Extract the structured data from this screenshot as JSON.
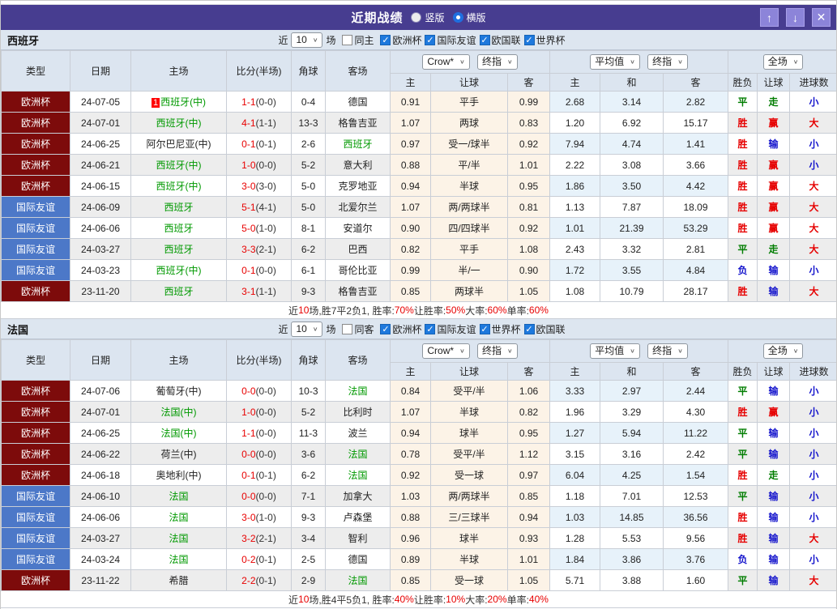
{
  "titlebar": {
    "title": "近期战绩",
    "radio_vertical": "竖版",
    "radio_horizontal": "横版",
    "btn_up": "↑",
    "btn_down": "↓",
    "btn_close": "✕"
  },
  "filter": {
    "near": "近",
    "count": "10",
    "games": "场"
  },
  "header": {
    "col_type": "类型",
    "col_date": "日期",
    "col_home": "主场",
    "col_score": "比分(半场)",
    "col_corner": "角球",
    "col_away": "客场",
    "sel_odds_source": "Crow*",
    "sel_odds_final": "终指",
    "odds_home": "主",
    "odds_handicap": "让球",
    "odds_away": "客",
    "sel_avg": "平均值",
    "sel_avg_final": "终指",
    "avg_home": "主",
    "avg_draw": "和",
    "avg_away": "客",
    "sel_scope": "全场",
    "res_wdl": "胜负",
    "res_handicap": "让球",
    "res_goals": "进球数"
  },
  "colors": {
    "titlebar_bg": "#473D90",
    "europe_cup_badge": "#7D0B0B",
    "friendly_badge": "#4C78C8",
    "team_green": "#009900",
    "score_red": "#E80000",
    "win_red": "#E60000",
    "draw_green": "#007D00",
    "lose_blue": "#1414CC",
    "odds_bg": "#FCF3E7",
    "avg_bg": "#E7F2FA",
    "header_bg": "#DCE5F0"
  },
  "sections": [
    {
      "team": "西班牙",
      "same_label": "同主",
      "competitions": [
        "欧洲杯",
        "国际友谊",
        "欧国联",
        "世界杯"
      ],
      "rows": [
        {
          "comp": "欧洲杯",
          "badge": "cup",
          "date": "24-07-05",
          "homeBadge": "1",
          "home": "西班牙(中)",
          "homeC": "g",
          "score": "1-1",
          "half": "(0-0)",
          "corner": "0-4",
          "away": "德国",
          "awayC": "k",
          "o": [
            "0.91",
            "平手",
            "0.99"
          ],
          "a": [
            "2.68",
            "3.14",
            "2.82"
          ],
          "r": [
            [
              "平",
              "g"
            ],
            [
              "走",
              "g"
            ],
            [
              "小",
              "b"
            ]
          ]
        },
        {
          "comp": "欧洲杯",
          "badge": "cup",
          "date": "24-07-01",
          "home": "西班牙(中)",
          "homeC": "g",
          "score": "4-1",
          "half": "(1-1)",
          "corner": "13-3",
          "away": "格鲁吉亚",
          "awayC": "k",
          "o": [
            "1.07",
            "两球",
            "0.83"
          ],
          "a": [
            "1.20",
            "6.92",
            "15.17"
          ],
          "r": [
            [
              "胜",
              "r"
            ],
            [
              "赢",
              "r"
            ],
            [
              "大",
              "r"
            ]
          ]
        },
        {
          "comp": "欧洲杯",
          "badge": "cup",
          "date": "24-06-25",
          "home": "阿尔巴尼亚(中)",
          "homeC": "k",
          "score": "0-1",
          "half": "(0-1)",
          "corner": "2-6",
          "away": "西班牙",
          "awayC": "g",
          "o": [
            "0.97",
            "受一/球半",
            "0.92"
          ],
          "a": [
            "7.94",
            "4.74",
            "1.41"
          ],
          "r": [
            [
              "胜",
              "r"
            ],
            [
              "输",
              "b"
            ],
            [
              "小",
              "b"
            ]
          ]
        },
        {
          "comp": "欧洲杯",
          "badge": "cup",
          "date": "24-06-21",
          "home": "西班牙(中)",
          "homeC": "g",
          "score": "1-0",
          "half": "(0-0)",
          "corner": "5-2",
          "away": "意大利",
          "awayC": "k",
          "o": [
            "0.88",
            "平/半",
            "1.01"
          ],
          "a": [
            "2.22",
            "3.08",
            "3.66"
          ],
          "r": [
            [
              "胜",
              "r"
            ],
            [
              "赢",
              "r"
            ],
            [
              "小",
              "b"
            ]
          ]
        },
        {
          "comp": "欧洲杯",
          "badge": "cup",
          "date": "24-06-15",
          "home": "西班牙(中)",
          "homeC": "g",
          "score": "3-0",
          "half": "(3-0)",
          "corner": "5-0",
          "away": "克罗地亚",
          "awayC": "k",
          "o": [
            "0.94",
            "半球",
            "0.95"
          ],
          "a": [
            "1.86",
            "3.50",
            "4.42"
          ],
          "r": [
            [
              "胜",
              "r"
            ],
            [
              "赢",
              "r"
            ],
            [
              "大",
              "r"
            ]
          ]
        },
        {
          "comp": "国际友谊",
          "badge": "fr",
          "date": "24-06-09",
          "home": "西班牙",
          "homeC": "g",
          "score": "5-1",
          "half": "(4-1)",
          "corner": "5-0",
          "away": "北爱尔兰",
          "awayC": "k",
          "o": [
            "1.07",
            "两/两球半",
            "0.81"
          ],
          "a": [
            "1.13",
            "7.87",
            "18.09"
          ],
          "r": [
            [
              "胜",
              "r"
            ],
            [
              "赢",
              "r"
            ],
            [
              "大",
              "r"
            ]
          ]
        },
        {
          "comp": "国际友谊",
          "badge": "fr",
          "date": "24-06-06",
          "home": "西班牙",
          "homeC": "g",
          "score": "5-0",
          "half": "(1-0)",
          "corner": "8-1",
          "away": "安道尔",
          "awayC": "k",
          "o": [
            "0.90",
            "四/四球半",
            "0.92"
          ],
          "a": [
            "1.01",
            "21.39",
            "53.29"
          ],
          "r": [
            [
              "胜",
              "r"
            ],
            [
              "赢",
              "r"
            ],
            [
              "大",
              "r"
            ]
          ]
        },
        {
          "comp": "国际友谊",
          "badge": "fr",
          "date": "24-03-27",
          "home": "西班牙",
          "homeC": "g",
          "score": "3-3",
          "half": "(2-1)",
          "corner": "6-2",
          "away": "巴西",
          "awayC": "k",
          "o": [
            "0.82",
            "平手",
            "1.08"
          ],
          "a": [
            "2.43",
            "3.32",
            "2.81"
          ],
          "r": [
            [
              "平",
              "g"
            ],
            [
              "走",
              "g"
            ],
            [
              "大",
              "r"
            ]
          ]
        },
        {
          "comp": "国际友谊",
          "badge": "fr",
          "date": "24-03-23",
          "home": "西班牙(中)",
          "homeC": "g",
          "score": "0-1",
          "half": "(0-0)",
          "corner": "6-1",
          "away": "哥伦比亚",
          "awayC": "k",
          "o": [
            "0.99",
            "半/一",
            "0.90"
          ],
          "a": [
            "1.72",
            "3.55",
            "4.84"
          ],
          "r": [
            [
              "负",
              "b"
            ],
            [
              "输",
              "b"
            ],
            [
              "小",
              "b"
            ]
          ]
        },
        {
          "comp": "欧洲杯",
          "badge": "cup",
          "date": "23-11-20",
          "home": "西班牙",
          "homeC": "g",
          "score": "3-1",
          "half": "(1-1)",
          "corner": "9-3",
          "away": "格鲁吉亚",
          "awayC": "k",
          "o": [
            "0.85",
            "两球半",
            "1.05"
          ],
          "a": [
            "1.08",
            "10.79",
            "28.17"
          ],
          "r": [
            [
              "胜",
              "r"
            ],
            [
              "输",
              "b"
            ],
            [
              "大",
              "r"
            ]
          ]
        }
      ],
      "summary": [
        [
          "近",
          "k"
        ],
        [
          "10",
          "r"
        ],
        [
          "场,胜7平2负1, 胜率:",
          "k"
        ],
        [
          "70%",
          "r"
        ],
        [
          " 让胜率:",
          "k"
        ],
        [
          "50%",
          "r"
        ],
        [
          " 大率:",
          "k"
        ],
        [
          "60%",
          "r"
        ],
        [
          " 单率:",
          "k"
        ],
        [
          "60%",
          "r"
        ]
      ]
    },
    {
      "team": "法国",
      "same_label": "同客",
      "competitions": [
        "欧洲杯",
        "国际友谊",
        "世界杯",
        "欧国联"
      ],
      "rows": [
        {
          "comp": "欧洲杯",
          "badge": "cup",
          "date": "24-07-06",
          "home": "葡萄牙(中)",
          "homeC": "k",
          "score": "0-0",
          "half": "(0-0)",
          "corner": "10-3",
          "away": "法国",
          "awayC": "g",
          "o": [
            "0.84",
            "受平/半",
            "1.06"
          ],
          "a": [
            "3.33",
            "2.97",
            "2.44"
          ],
          "r": [
            [
              "平",
              "g"
            ],
            [
              "输",
              "b"
            ],
            [
              "小",
              "b"
            ]
          ]
        },
        {
          "comp": "欧洲杯",
          "badge": "cup",
          "date": "24-07-01",
          "home": "法国(中)",
          "homeC": "g",
          "score": "1-0",
          "half": "(0-0)",
          "corner": "5-2",
          "away": "比利时",
          "awayC": "k",
          "o": [
            "1.07",
            "半球",
            "0.82"
          ],
          "a": [
            "1.96",
            "3.29",
            "4.30"
          ],
          "r": [
            [
              "胜",
              "r"
            ],
            [
              "赢",
              "r"
            ],
            [
              "小",
              "b"
            ]
          ]
        },
        {
          "comp": "欧洲杯",
          "badge": "cup",
          "date": "24-06-25",
          "home": "法国(中)",
          "homeC": "g",
          "score": "1-1",
          "half": "(0-0)",
          "corner": "11-3",
          "away": "波兰",
          "awayC": "k",
          "o": [
            "0.94",
            "球半",
            "0.95"
          ],
          "a": [
            "1.27",
            "5.94",
            "11.22"
          ],
          "r": [
            [
              "平",
              "g"
            ],
            [
              "输",
              "b"
            ],
            [
              "小",
              "b"
            ]
          ]
        },
        {
          "comp": "欧洲杯",
          "badge": "cup",
          "date": "24-06-22",
          "home": "荷兰(中)",
          "homeC": "k",
          "score": "0-0",
          "half": "(0-0)",
          "corner": "3-6",
          "away": "法国",
          "awayC": "g",
          "o": [
            "0.78",
            "受平/半",
            "1.12"
          ],
          "a": [
            "3.15",
            "3.16",
            "2.42"
          ],
          "r": [
            [
              "平",
              "g"
            ],
            [
              "输",
              "b"
            ],
            [
              "小",
              "b"
            ]
          ]
        },
        {
          "comp": "欧洲杯",
          "badge": "cup",
          "date": "24-06-18",
          "home": "奥地利(中)",
          "homeC": "k",
          "score": "0-1",
          "half": "(0-1)",
          "corner": "6-2",
          "away": "法国",
          "awayC": "g",
          "o": [
            "0.92",
            "受一球",
            "0.97"
          ],
          "a": [
            "6.04",
            "4.25",
            "1.54"
          ],
          "r": [
            [
              "胜",
              "r"
            ],
            [
              "走",
              "g"
            ],
            [
              "小",
              "b"
            ]
          ]
        },
        {
          "comp": "国际友谊",
          "badge": "fr",
          "date": "24-06-10",
          "home": "法国",
          "homeC": "g",
          "score": "0-0",
          "half": "(0-0)",
          "corner": "7-1",
          "away": "加拿大",
          "awayC": "k",
          "o": [
            "1.03",
            "两/两球半",
            "0.85"
          ],
          "a": [
            "1.18",
            "7.01",
            "12.53"
          ],
          "r": [
            [
              "平",
              "g"
            ],
            [
              "输",
              "b"
            ],
            [
              "小",
              "b"
            ]
          ]
        },
        {
          "comp": "国际友谊",
          "badge": "fr",
          "date": "24-06-06",
          "home": "法国",
          "homeC": "g",
          "score": "3-0",
          "half": "(1-0)",
          "corner": "9-3",
          "away": "卢森堡",
          "awayC": "k",
          "o": [
            "0.88",
            "三/三球半",
            "0.94"
          ],
          "a": [
            "1.03",
            "14.85",
            "36.56"
          ],
          "r": [
            [
              "胜",
              "r"
            ],
            [
              "输",
              "b"
            ],
            [
              "小",
              "b"
            ]
          ]
        },
        {
          "comp": "国际友谊",
          "badge": "fr",
          "date": "24-03-27",
          "home": "法国",
          "homeC": "g",
          "score": "3-2",
          "half": "(2-1)",
          "corner": "3-4",
          "away": "智利",
          "awayC": "k",
          "o": [
            "0.96",
            "球半",
            "0.93"
          ],
          "a": [
            "1.28",
            "5.53",
            "9.56"
          ],
          "r": [
            [
              "胜",
              "r"
            ],
            [
              "输",
              "b"
            ],
            [
              "大",
              "r"
            ]
          ]
        },
        {
          "comp": "国际友谊",
          "badge": "fr",
          "date": "24-03-24",
          "home": "法国",
          "homeC": "g",
          "score": "0-2",
          "half": "(0-1)",
          "corner": "2-5",
          "away": "德国",
          "awayC": "k",
          "o": [
            "0.89",
            "半球",
            "1.01"
          ],
          "a": [
            "1.84",
            "3.86",
            "3.76"
          ],
          "r": [
            [
              "负",
              "b"
            ],
            [
              "输",
              "b"
            ],
            [
              "小",
              "b"
            ]
          ]
        },
        {
          "comp": "欧洲杯",
          "badge": "cup",
          "date": "23-11-22",
          "home": "希腊",
          "homeC": "k",
          "score": "2-2",
          "half": "(0-1)",
          "corner": "2-9",
          "away": "法国",
          "awayC": "g",
          "o": [
            "0.85",
            "受一球",
            "1.05"
          ],
          "a": [
            "5.71",
            "3.88",
            "1.60"
          ],
          "r": [
            [
              "平",
              "g"
            ],
            [
              "输",
              "b"
            ],
            [
              "大",
              "r"
            ]
          ]
        }
      ],
      "summary": [
        [
          "近",
          "k"
        ],
        [
          "10",
          "r"
        ],
        [
          "场,胜4平5负1, 胜率:",
          "k"
        ],
        [
          "40%",
          "r"
        ],
        [
          " 让胜率:",
          "k"
        ],
        [
          "10%",
          "r"
        ],
        [
          " 大率:",
          "k"
        ],
        [
          "20%",
          "r"
        ],
        [
          " 单率:",
          "k"
        ],
        [
          "40%",
          "r"
        ]
      ]
    }
  ]
}
